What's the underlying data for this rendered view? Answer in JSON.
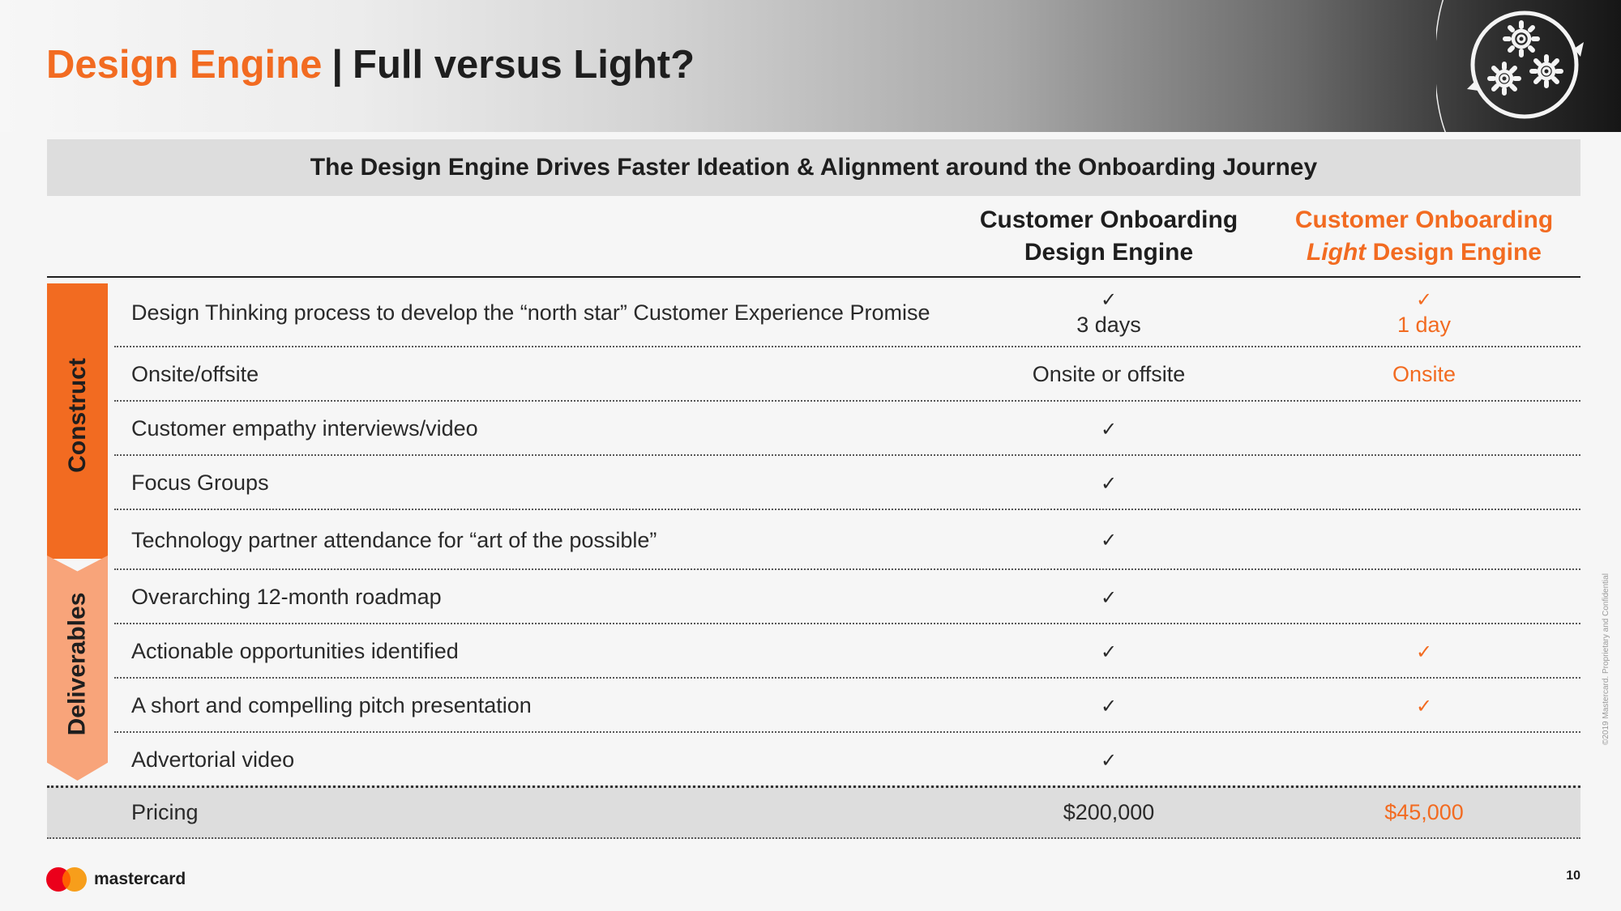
{
  "title": {
    "accent": "Design Engine",
    "separator": "|",
    "main": "Full versus Light?"
  },
  "banner": "The Design Engine Drives Faster Ideation & Alignment around the Onboarding Journey",
  "columns": {
    "full": {
      "line1": "Customer Onboarding",
      "line2": "Design Engine"
    },
    "light": {
      "line1": "Customer Onboarding",
      "line2_italic": "Light",
      "line2_rest": " Design Engine"
    }
  },
  "sections": {
    "construct": "Construct",
    "deliverables": "Deliverables"
  },
  "rows": [
    {
      "label": "Design Thinking process to develop the “north star” Customer Experience Promise",
      "full_check": "✓",
      "full_text": "3 days",
      "light_check": "✓",
      "light_text": "1 day"
    },
    {
      "label": "Onsite/offsite",
      "full_text": "Onsite or offsite",
      "light_text": "Onsite"
    },
    {
      "label": "Customer empathy interviews/video",
      "full_check": "✓"
    },
    {
      "label": "Focus Groups",
      "full_check": "✓"
    },
    {
      "label": "Technology partner attendance for “art of the possible”",
      "full_check": "✓"
    },
    {
      "label": "Overarching 12-month roadmap",
      "full_check": "✓"
    },
    {
      "label": "Actionable opportunities identified",
      "full_check": "✓",
      "light_check": "✓"
    },
    {
      "label": "A short and compelling pitch presentation",
      "full_check": "✓",
      "light_check": "✓"
    },
    {
      "label": "Advertorial video",
      "full_check": "✓"
    }
  ],
  "pricing": {
    "label": "Pricing",
    "full": "$200,000",
    "light": "$45,000"
  },
  "footer": {
    "brand": "mastercard",
    "page_number": "10",
    "copyright": "©2019 Mastercard. Proprietary and Confidential"
  },
  "icons": [
    "gears-cycle-icon",
    "mastercard-logo-icon"
  ],
  "colors": {
    "accent": "#f26b21",
    "accent_light": "#f8a47a",
    "text": "#1e1e1e",
    "band": "#dddddd"
  }
}
